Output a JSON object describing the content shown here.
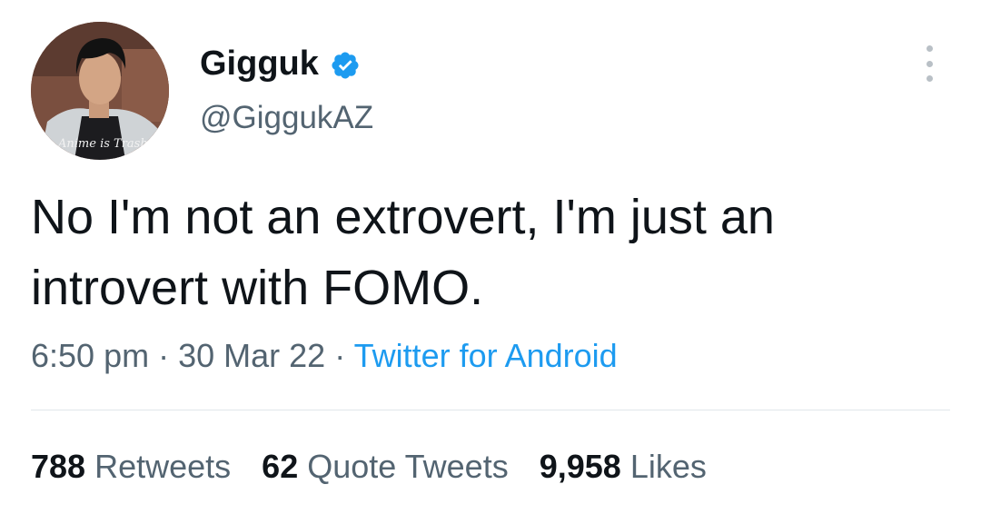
{
  "tweet": {
    "author": {
      "display_name": "Gigguk",
      "handle": "@GiggukAZ",
      "verified": true,
      "avatar_shirt_text": "Anime is Trash"
    },
    "text_line_1": "No I'm not an extrovert, I'm just an",
    "text_line_2": "introvert with FOMO.",
    "time": "6:50 pm",
    "date": "30 Mar 22",
    "separator": "·",
    "source": "Twitter for Android",
    "stats": {
      "retweets": {
        "count": "788",
        "label": "Retweets"
      },
      "quote_tweets": {
        "count": "62",
        "label": "Quote Tweets"
      },
      "likes": {
        "count": "9,958",
        "label": "Likes"
      }
    }
  },
  "icons": {
    "verified": "verified-badge-icon",
    "more": "more-options-icon"
  },
  "colors": {
    "text_primary": "#0f1419",
    "text_secondary": "#536471",
    "link_blue": "#1d9bf0",
    "divider": "#e1e6ea"
  }
}
